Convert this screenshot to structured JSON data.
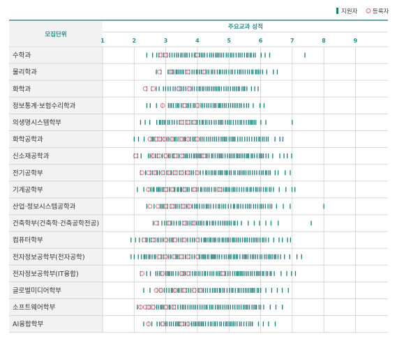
{
  "legend": {
    "applicant_label": "지원자",
    "registrant_label": "등록자"
  },
  "header": {
    "unit_label": "모집단위",
    "axis_label": "주요교과 성적"
  },
  "colors": {
    "applicant": "#1f7a7a",
    "registrant": "#e0707f",
    "header_text": "#2f8a8e",
    "label_bg": "#f2f2f2",
    "line_border": "#d5d5d5"
  },
  "chart_data": {
    "type": "scatter",
    "title": "",
    "xlabel": "주요교과 성적",
    "xlim": [
      1,
      9
    ],
    "ticks": [
      1,
      2,
      3,
      4,
      5,
      6,
      7,
      8,
      9
    ],
    "grid": true,
    "legend_position": "top-right",
    "series": [
      {
        "name": "지원자",
        "marker": "tick"
      },
      {
        "name": "등록자",
        "marker": "open-circle"
      }
    ],
    "categories": [
      "수학과",
      "물리학과",
      "화학과",
      "정보통계·보험수리학과",
      "의생명시스템학부",
      "화학공학과",
      "신소재공학과",
      "전기공학부",
      "기계공학부",
      "산업·정보시스템공학과",
      "건축학부(건축학·건축공학전공)",
      "컴퓨터학부",
      "전자정보공학부(전자공학)",
      "전자정보공학부(IT융합)",
      "글로벌미디어학부",
      "소프트웨어학부",
      "AI융합학부"
    ],
    "rows": [
      {
        "category": "수학과",
        "applicants": {
          "min": 2.4,
          "max": 6.3,
          "dense_min": 2.7,
          "dense_max": 5.8,
          "outliers": [
            7.4
          ]
        },
        "registrants": [
          2.85,
          3.0,
          4.0
        ]
      },
      {
        "category": "물리학과",
        "applicants": {
          "min": 2.7,
          "max": 6.6,
          "dense_min": 3.0,
          "dense_max": 6.0,
          "outliers": []
        },
        "registrants": [
          2.8,
          3.15,
          3.7,
          4.2
        ]
      },
      {
        "category": "화학과",
        "applicants": {
          "min": 2.4,
          "max": 6.0,
          "dense_min": 2.8,
          "dense_max": 5.5,
          "outliers": []
        },
        "registrants": [
          2.35,
          2.6,
          3.4,
          3.75
        ]
      },
      {
        "category": "정보통계·보험수리학과",
        "applicants": {
          "min": 2.4,
          "max": 6.2,
          "dense_min": 2.9,
          "dense_max": 5.6,
          "outliers": []
        },
        "registrants": [
          2.9,
          3.6,
          4.0
        ]
      },
      {
        "category": "의생명시스템학부",
        "applicants": {
          "min": 2.2,
          "max": 6.2,
          "dense_min": 2.6,
          "dense_max": 5.8,
          "outliers": [
            7.0
          ]
        },
        "registrants": [
          3.5,
          3.7,
          3.9
        ]
      },
      {
        "category": "화학공학과",
        "applicants": {
          "min": 2.0,
          "max": 6.8,
          "dense_min": 2.4,
          "dense_max": 6.2,
          "outliers": []
        },
        "registrants": [
          2.5,
          2.7,
          2.8,
          2.95,
          3.2,
          3.5,
          3.7,
          4.0
        ]
      },
      {
        "category": "신소재공학과",
        "applicants": {
          "min": 2.0,
          "max": 7.0,
          "dense_min": 2.4,
          "dense_max": 6.2,
          "outliers": []
        },
        "registrants": [
          2.05,
          2.6,
          2.8,
          3.0,
          3.3,
          3.5,
          4.2
        ]
      },
      {
        "category": "전기공학부",
        "applicants": {
          "min": 2.2,
          "max": 7.0,
          "dense_min": 2.5,
          "dense_max": 6.3,
          "outliers": []
        },
        "registrants": [
          2.25,
          2.45,
          2.65,
          2.9,
          3.1,
          3.3,
          3.5,
          3.7,
          4.0
        ]
      },
      {
        "category": "기계공학부",
        "applicants": {
          "min": 2.1,
          "max": 7.3,
          "dense_min": 2.4,
          "dense_max": 6.4,
          "outliers": []
        },
        "registrants": [
          2.45,
          3.0,
          3.2,
          3.6,
          3.9,
          4.7
        ]
      },
      {
        "category": "산업·정보시스템공학과",
        "applicants": {
          "min": 2.4,
          "max": 7.0,
          "dense_min": 2.7,
          "dense_max": 6.3,
          "outliers": [
            8.0
          ]
        },
        "registrants": [
          2.5,
          2.75,
          3.0,
          3.2,
          3.55,
          3.75
        ]
      },
      {
        "category": "건축학부(건축학·건축공학전공)",
        "applicants": {
          "min": 2.6,
          "max": 6.6,
          "dense_min": 2.8,
          "dense_max": 5.2,
          "outliers": [
            7.6
          ]
        },
        "registrants": [
          2.7,
          3.1,
          3.6,
          3.9
        ]
      },
      {
        "category": "컴퓨터학부",
        "applicants": {
          "min": 1.9,
          "max": 7.0,
          "dense_min": 2.3,
          "dense_max": 6.2,
          "outliers": []
        },
        "registrants": [
          2.3,
          2.6,
          3.0,
          3.3,
          3.6,
          4.0
        ]
      },
      {
        "category": "전자정보공학부(전자공학)",
        "applicants": {
          "min": 1.9,
          "max": 7.3,
          "dense_min": 2.2,
          "dense_max": 6.6,
          "outliers": []
        },
        "registrants": [
          2.8,
          3.0,
          3.25,
          3.5,
          3.7,
          4.0
        ]
      },
      {
        "category": "전자정보공학부(IT융합)",
        "applicants": {
          "min": 2.2,
          "max": 7.2,
          "dense_min": 2.6,
          "dense_max": 6.3,
          "outliers": []
        },
        "registrants": [
          2.25,
          2.9,
          3.5,
          3.7,
          4.8
        ]
      },
      {
        "category": "글로벌미디어학부",
        "applicants": {
          "min": 2.3,
          "max": 7.0,
          "dense_min": 2.6,
          "dense_max": 6.0,
          "outliers": []
        },
        "registrants": [
          2.7,
          2.85,
          3.3,
          3.6,
          3.9,
          4.1
        ]
      },
      {
        "category": "소프트웨어학부",
        "applicants": {
          "min": 2.1,
          "max": 6.8,
          "dense_min": 2.2,
          "dense_max": 6.0,
          "outliers": []
        },
        "registrants": [
          2.2,
          2.35,
          2.45,
          2.6,
          3.0,
          3.25
        ]
      },
      {
        "category": "AI융합학부",
        "applicants": {
          "min": 2.3,
          "max": 6.5,
          "dense_min": 2.6,
          "dense_max": 5.7,
          "outliers": []
        },
        "registrants": [
          2.45,
          2.9,
          3.5,
          3.7
        ]
      }
    ]
  }
}
